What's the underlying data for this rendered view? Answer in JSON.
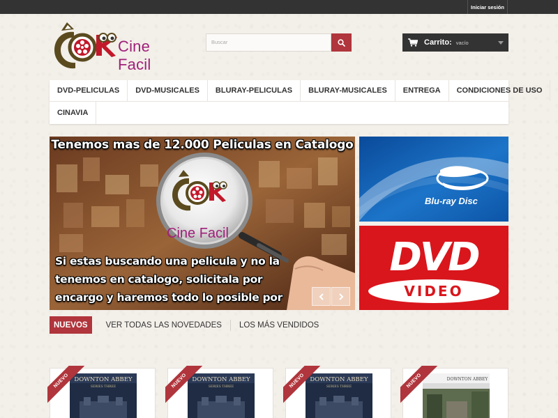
{
  "header": {
    "login_label": "Iniciar sesión"
  },
  "logo": {
    "text": "Cine Facil"
  },
  "search": {
    "placeholder": "Buscar",
    "icon": "search-icon"
  },
  "cart": {
    "label": "Carrito:",
    "status": "vacío",
    "icon": "cart-icon"
  },
  "nav": {
    "items": [
      {
        "label": "DVD-PELICULAS"
      },
      {
        "label": "DVD-MUSICALES"
      },
      {
        "label": "BLURAY-PELICULAS"
      },
      {
        "label": "BLURAY-MUSICALES"
      },
      {
        "label": "ENTREGA"
      },
      {
        "label": "CONDICIONES DE USO"
      },
      {
        "label": "CINAVIA"
      }
    ]
  },
  "hero": {
    "headline": "Tenemos mas de 12.000 Peliculas en Catalogo",
    "brand": "Cine Facil",
    "body": "Si estas buscando una pelicula y no la tenemos en catalogo, solicitala por encargo y haremos todo lo posible por conseguirtela",
    "prev_icon": "chevron-left-icon",
    "next_icon": "chevron-right-icon"
  },
  "banners": {
    "bluray_text": "Blu-ray Disc",
    "dvd_text": "DVD",
    "dvd_sub": "VIDEO",
    "colors": {
      "bluray": "#1c6ec0",
      "dvd": "#d9161c"
    }
  },
  "tabs": {
    "active": "NUEVOS",
    "items": [
      "VER TODAS LAS NOVEDADES",
      "LOS MÁS VENDIDOS"
    ]
  },
  "products": [
    {
      "ribbon": "NUEVO",
      "cover_title": "DOWNTON ABBEY",
      "cover_sub": "SERIES THREE"
    },
    {
      "ribbon": "NUEVO",
      "cover_title": "DOWNTON ABBEY",
      "cover_sub": "SERIES THREE"
    },
    {
      "ribbon": "NUEVO",
      "cover_title": "DOWNTON ABBEY",
      "cover_sub": "SERIES THREE"
    },
    {
      "ribbon": "NUEVO",
      "cover_title": "DOWNTON ABBEY",
      "cover_sub": ""
    }
  ],
  "colors": {
    "accent": "#b0353c",
    "topbar": "#333333",
    "brand": "#a0207a"
  }
}
